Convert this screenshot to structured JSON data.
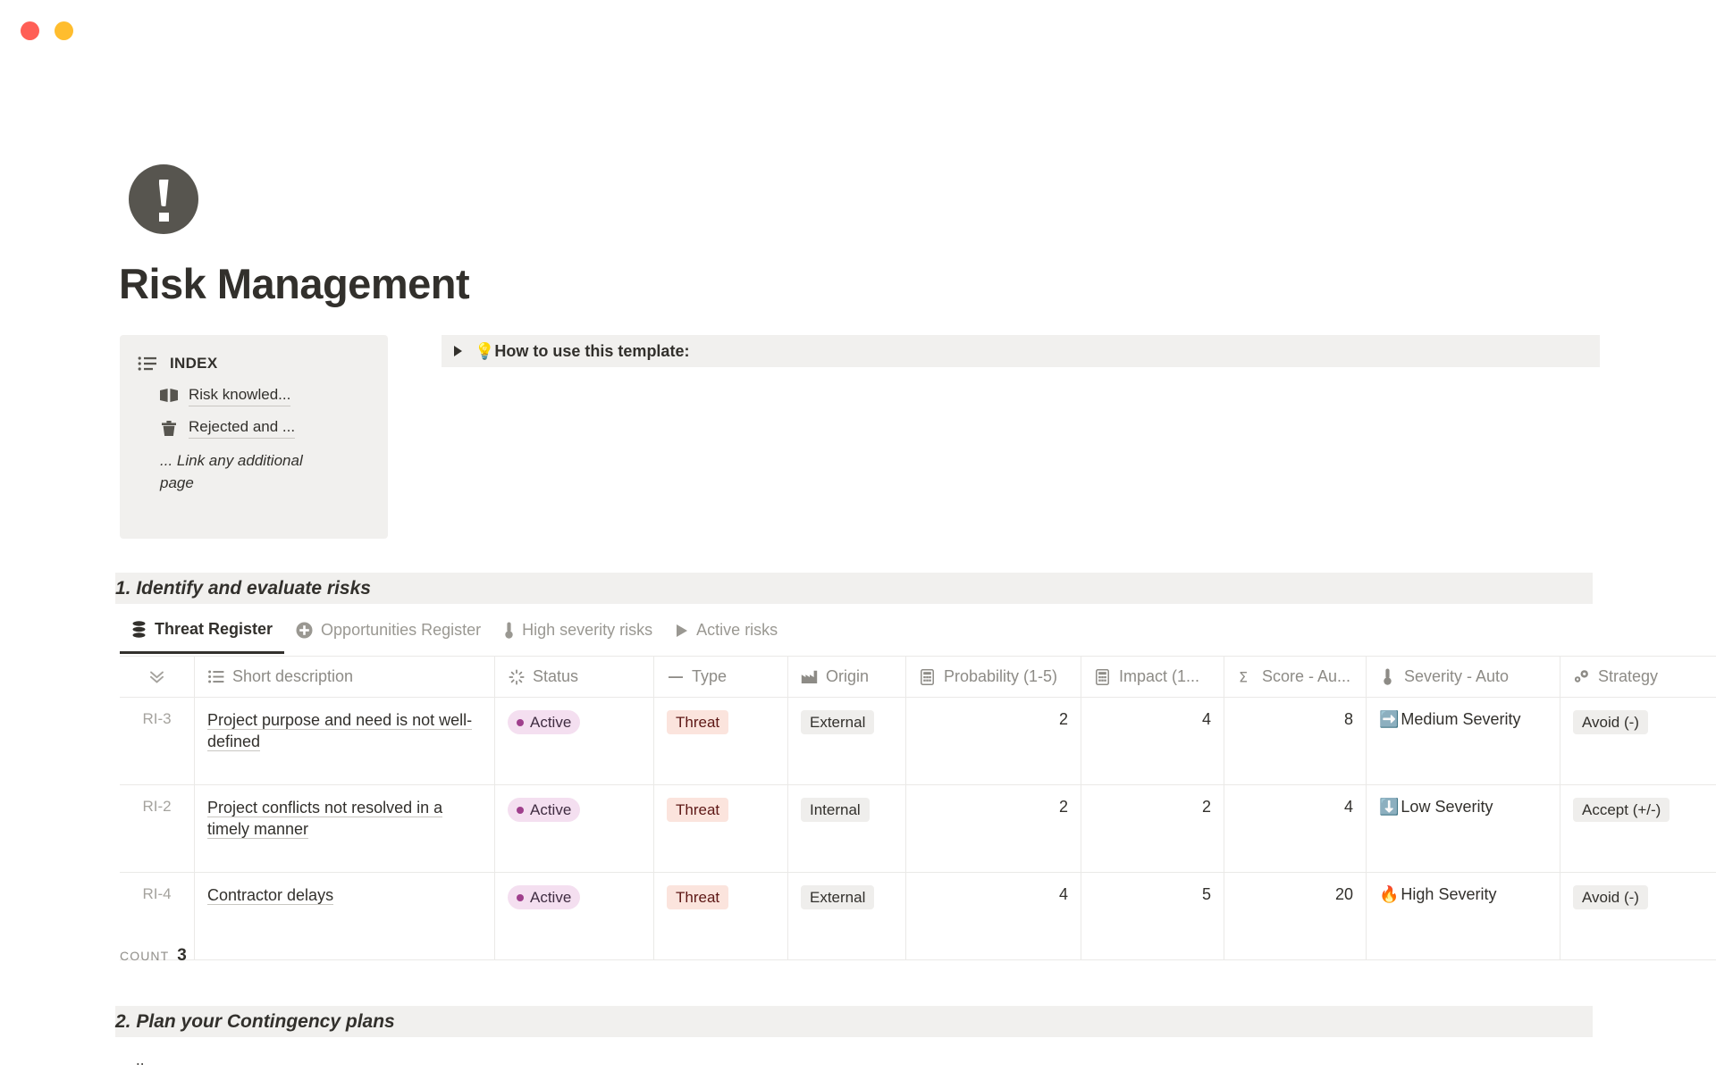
{
  "window": {
    "controls": [
      {
        "name": "close",
        "color": "#ff5f56"
      },
      {
        "name": "minimize",
        "color": "#ffbd2e"
      },
      {
        "name": "maximize",
        "color": "#13c17"
      }
    ]
  },
  "page": {
    "icon": "exclamation-mark-circle",
    "title": "Risk Management"
  },
  "index": {
    "icon": "list-icon",
    "label": "INDEX",
    "links": [
      {
        "icon": "open-book-icon",
        "label": "Risk knowled..."
      },
      {
        "icon": "trash-icon",
        "label": "Rejected and ..."
      }
    ],
    "note": "... Link any additional page"
  },
  "callout": {
    "toggle_icon": "triangle-right-icon",
    "emoji": "💡",
    "text": "How to use this template:"
  },
  "sections": {
    "one": "1. Identify and evaluate risks",
    "two": "2. Plan your Contingency plans",
    "two_stub": ".."
  },
  "tabs": [
    {
      "icon": "database-icon",
      "label": "Threat Register",
      "active": true
    },
    {
      "icon": "plus-circle-icon",
      "label": "Opportunities Register",
      "active": false
    },
    {
      "icon": "thermometer-icon",
      "label": "High severity risks",
      "active": false
    },
    {
      "icon": "play-icon",
      "label": "Active risks",
      "active": false
    }
  ],
  "table": {
    "columns": [
      {
        "key": "handle",
        "icon": "double-chevron-down-icon",
        "label": ""
      },
      {
        "key": "desc",
        "icon": "list-bullets-icon",
        "label": "Short description"
      },
      {
        "key": "status",
        "icon": "loading-spinner-icon",
        "label": "Status"
      },
      {
        "key": "type",
        "icon": "dash-icon",
        "label": "Type"
      },
      {
        "key": "origin",
        "icon": "factory-icon",
        "label": "Origin"
      },
      {
        "key": "prob",
        "icon": "grid-number-icon",
        "label": "Probability (1-5)"
      },
      {
        "key": "impact",
        "icon": "grid-number-icon",
        "label": "Impact (1..."
      },
      {
        "key": "score",
        "icon": "sigma-icon",
        "label": "Score - Au..."
      },
      {
        "key": "sev",
        "icon": "thermometer-icon",
        "label": "Severity - Auto"
      },
      {
        "key": "strat",
        "icon": "gears-icon",
        "label": "Strategy"
      }
    ],
    "rows": [
      {
        "id": "RI-3",
        "desc": "Project purpose and need is not well-defined",
        "status": "Active",
        "type": "Threat",
        "origin": "External",
        "prob": "2",
        "impact": "4",
        "score": "8",
        "sev_emoji": "➡️",
        "sev": "Medium Severity",
        "strategy": "Avoid (-)"
      },
      {
        "id": "RI-2",
        "desc": "Project conflicts not resolved in a timely manner",
        "status": "Active",
        "type": "Threat",
        "origin": "Internal",
        "prob": "2",
        "impact": "2",
        "score": "4",
        "sev_emoji": "⬇️",
        "sev": "Low Severity",
        "strategy": "Accept (+/-)"
      },
      {
        "id": "RI-4",
        "desc": "Contractor delays",
        "status": "Active",
        "type": "Threat",
        "origin": "External",
        "prob": "4",
        "impact": "5",
        "score": "20",
        "sev_emoji": "🔥",
        "sev": "High Severity",
        "strategy": "Avoid (-)"
      }
    ],
    "footer": {
      "label": "COUNT",
      "value": "3"
    }
  },
  "colors": {
    "accent_dark": "#32302c",
    "muted": "#8d8b86",
    "panel_bg": "#f1f0ee",
    "status_pill_bg": "#f4dff0",
    "threat_pill_bg": "#fbe4dd",
    "neutral_pill_bg": "#efeeec"
  }
}
